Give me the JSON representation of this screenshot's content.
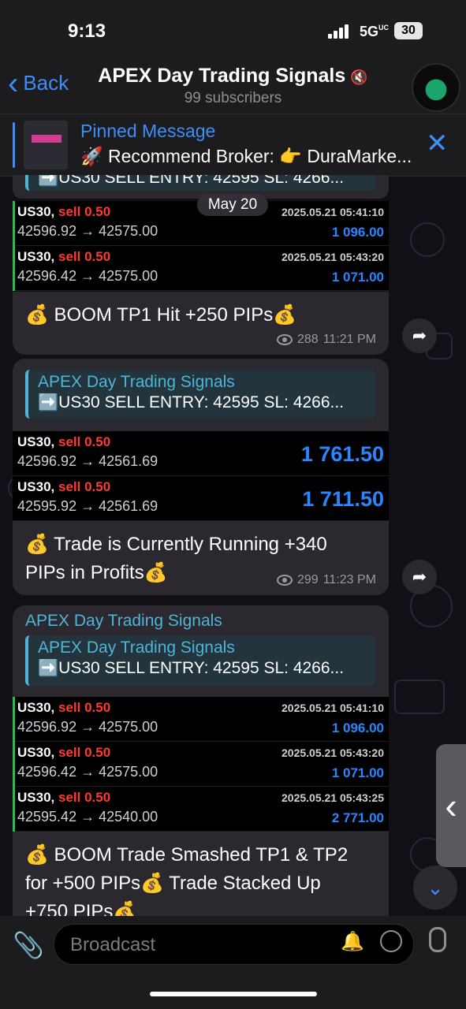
{
  "status": {
    "time": "9:13",
    "network": "5G",
    "network_sup": "UC",
    "battery": "30"
  },
  "header": {
    "back_label": "Back",
    "title": "APEX Day Trading Signals",
    "subscribers": "99 subscribers"
  },
  "pinned": {
    "title": "Pinned Message",
    "text": "🚀 Recommend Broker: 👉 DuraMarke..."
  },
  "date_pill": "May 20",
  "top_reply_text": "➡️US30 SELL ENTRY: 42595 SL: 4266...",
  "msg1": {
    "rows": [
      {
        "symbol": "US30,",
        "side": "sell 0.50",
        "prices": "42596.92 → 42575.00",
        "datetime": "2025.05.21 05:41:10",
        "profit": "1 096.00"
      },
      {
        "symbol": "US30,",
        "side": "sell 0.50",
        "prices": "42596.42 → 42575.00",
        "datetime": "2025.05.21 05:43:20",
        "profit": "1 071.00"
      }
    ],
    "text": "💰 BOOM TP1 Hit +250 PIPs💰",
    "views": "288",
    "time": "11:21 PM"
  },
  "msg2": {
    "reply_name": "APEX Day Trading Signals",
    "reply_text": "➡️US30 SELL ENTRY: 42595 SL: 4266...",
    "rows": [
      {
        "symbol": "US30,",
        "side": "sell 0.50",
        "prices": "42596.92 → 42561.69",
        "profit": "1 761.50"
      },
      {
        "symbol": "US30,",
        "side": "sell 0.50",
        "prices": "42595.92 → 42561.69",
        "profit": "1 711.50"
      }
    ],
    "text_line1": "💰 Trade is Currently Running +340",
    "text_line2": "PIPs in Profits💰",
    "views": "299",
    "time": "11:23 PM"
  },
  "msg3": {
    "sender": "APEX Day Trading Signals",
    "reply_name": "APEX Day Trading Signals",
    "reply_text": "➡️US30 SELL ENTRY: 42595 SL: 4266...",
    "rows": [
      {
        "symbol": "US30,",
        "side": "sell 0.50",
        "prices": "42596.92 → 42575.00",
        "datetime": "2025.05.21 05:41:10",
        "profit": "1 096.00"
      },
      {
        "symbol": "US30,",
        "side": "sell 0.50",
        "prices": "42596.42 → 42575.00",
        "datetime": "2025.05.21 05:43:20",
        "profit": "1 071.00"
      },
      {
        "symbol": "US30,",
        "side": "sell 0.50",
        "prices": "42595.42 → 42540.00",
        "datetime": "2025.05.21 05:43:25",
        "profit": "2 771.00"
      }
    ],
    "text_line1": "💰 BOOM Trade Smashed TP1 & TP2",
    "text_line2": "for +500 PIPs💰 Trade Stacked Up",
    "text_line3": "+750 PIPs💰"
  },
  "composer": {
    "placeholder": "Broadcast"
  },
  "icons": {
    "forward": "forward-arrow-icon",
    "scroll_down": "chevron-down-icon",
    "attach": "paperclip-icon"
  }
}
